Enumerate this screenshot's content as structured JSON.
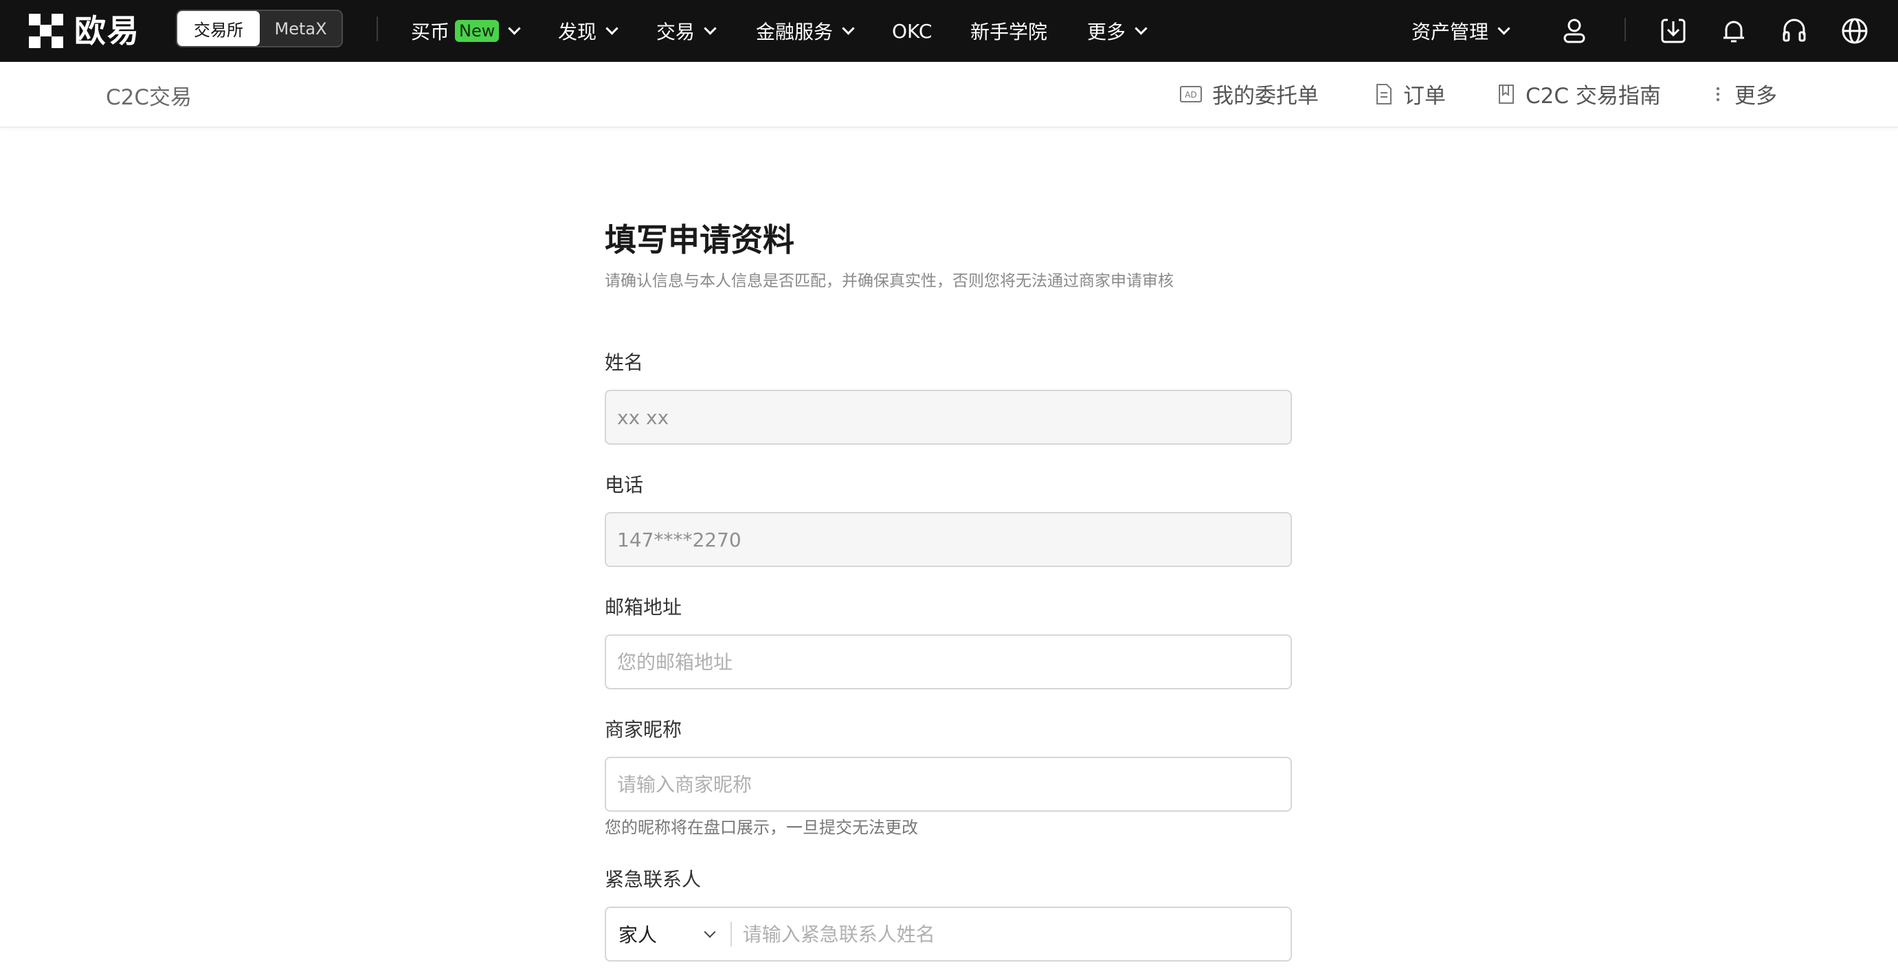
{
  "brand": {
    "name": "欧易"
  },
  "switcher": {
    "exchange": "交易所",
    "metax": "MetaX"
  },
  "nav": {
    "buy": "买币",
    "buy_badge": "New",
    "discover": "发现",
    "trade": "交易",
    "finance": "金融服务",
    "okc": "OKC",
    "academy": "新手学院",
    "more": "更多",
    "assets": "资产管理"
  },
  "subnav": {
    "title": "C2C交易",
    "my_ads": "我的委托单",
    "orders": "订单",
    "guide": "C2C 交易指南",
    "more": "更多"
  },
  "form": {
    "title": "填写申请资料",
    "subtitle": "请确认信息与本人信息是否匹配，并确保真实性，否则您将无法通过商家申请审核",
    "name_label": "姓名",
    "name_value": "xx xx",
    "phone_label": "电话",
    "phone_value": "147****2270",
    "email_label": "邮箱地址",
    "email_placeholder": "您的邮箱地址",
    "nickname_label": "商家昵称",
    "nickname_placeholder": "请输入商家昵称",
    "nickname_hint": "您的昵称将在盘口展示，一旦提交无法更改",
    "contact_label": "紧急联系人",
    "contact_relation": "家人",
    "contact_placeholder": "请输入紧急联系人姓名"
  },
  "colors": {
    "topbar": "#121212",
    "badge_green": "#4ad34a"
  }
}
